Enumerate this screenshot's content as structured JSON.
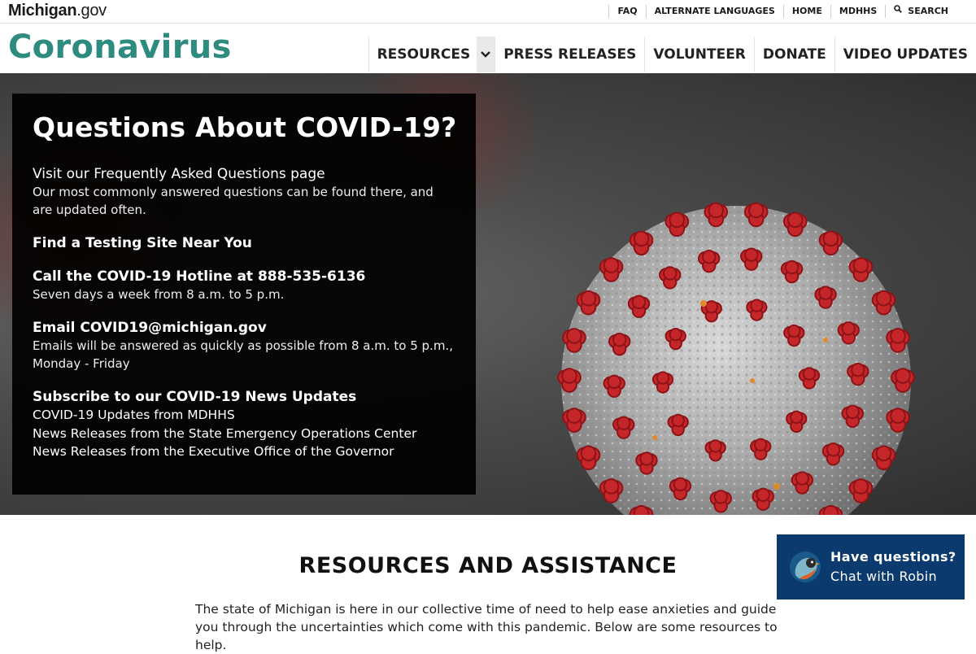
{
  "header": {
    "logo_main": "Michigan",
    "logo_suffix": ".gov",
    "util_nav": {
      "faq": "FAQ",
      "languages": "ALTERNATE LANGUAGES",
      "home": "HOME",
      "mdhhs": "MDHHS",
      "search": "SEARCH"
    },
    "site_title": "Coronavirus",
    "main_nav": {
      "resources": "RESOURCES",
      "press": "PRESS RELEASES",
      "volunteer": "VOLUNTEER",
      "donate": "DONATE",
      "video": "VIDEO UPDATES"
    }
  },
  "hero": {
    "title": "Questions About COVID-19?",
    "faq_link": "Visit our Frequently Asked Questions page",
    "faq_desc": "Our most commonly answered questions can be found there, and are updated often.",
    "testing_link": "Find a Testing Site Near You",
    "hotline": "Call the COVID-19 Hotline at 888-535-6136",
    "hotline_desc": "Seven days a week from 8 a.m. to 5 p.m.",
    "email": "Email COVID19@michigan.gov",
    "email_desc": "Emails will be answered as quickly as possible from 8 a.m. to 5 p.m., Monday - Friday",
    "subscribe": "Subscribe to our COVID-19 News Updates",
    "sub_links": [
      "COVID-19 Updates from MDHHS",
      "News Releases from the State Emergency Operations Center",
      "News Releases from the Executive Office of the Governor"
    ]
  },
  "resources": {
    "title": "RESOURCES AND ASSISTANCE",
    "description": "The state of Michigan is here in our collective time of need to help ease anxieties and guide you through the uncertainties which come with this pandemic. Below are some resources to help."
  },
  "chat": {
    "line1": "Have questions?",
    "line2": "Chat with Robin"
  },
  "colors": {
    "brand_teal": "#2e8b7f",
    "panel_bg": "#000000",
    "chat_bg": "#0b3a6e"
  }
}
